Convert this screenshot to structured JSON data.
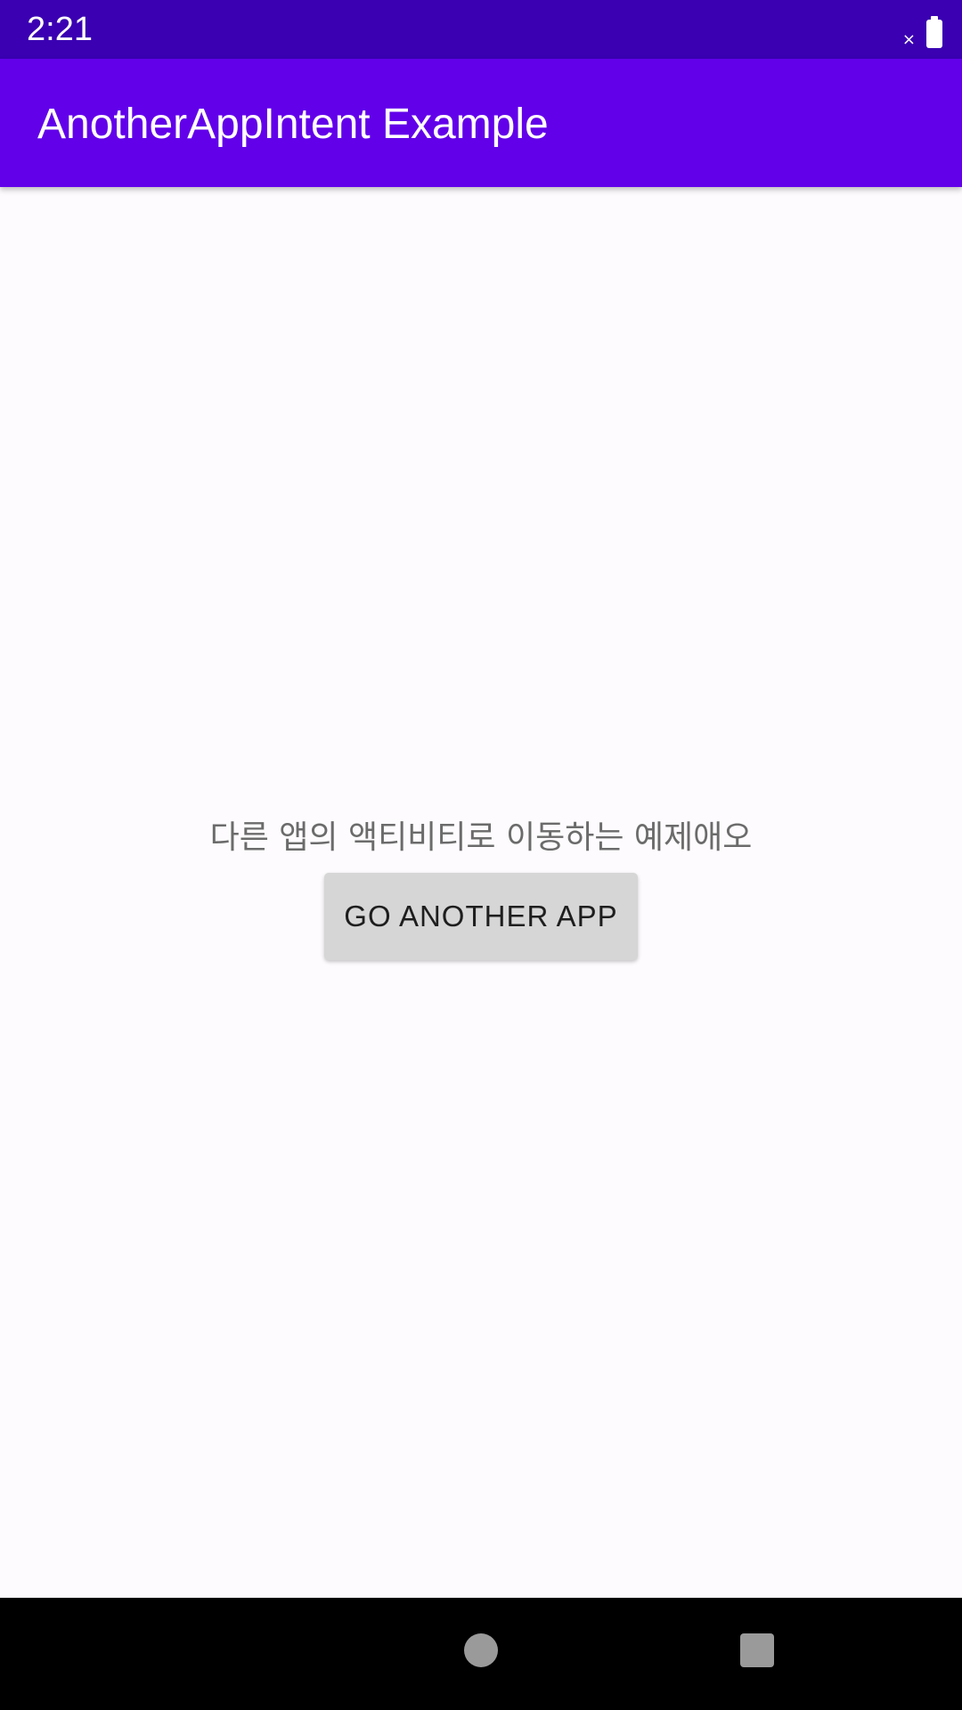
{
  "status_bar": {
    "time": "2:21",
    "signal_icon": "signal-off-icon",
    "signal_glyph": "×",
    "battery_icon": "battery-full-icon"
  },
  "app_bar": {
    "title": "AnotherAppIntent Example",
    "color": "#6200ea"
  },
  "main": {
    "message": "다른 앱의 액티비티로 이동하는 예제애오",
    "button_label": "GO ANOTHER APP"
  },
  "nav_bar": {
    "home_icon": "home-circle-icon",
    "recents_icon": "recents-square-icon"
  },
  "colors": {
    "status_bar": "#3a00b2",
    "app_bar": "#6200ea",
    "button": "#d6d6d6",
    "background": "#fdfbfd"
  }
}
